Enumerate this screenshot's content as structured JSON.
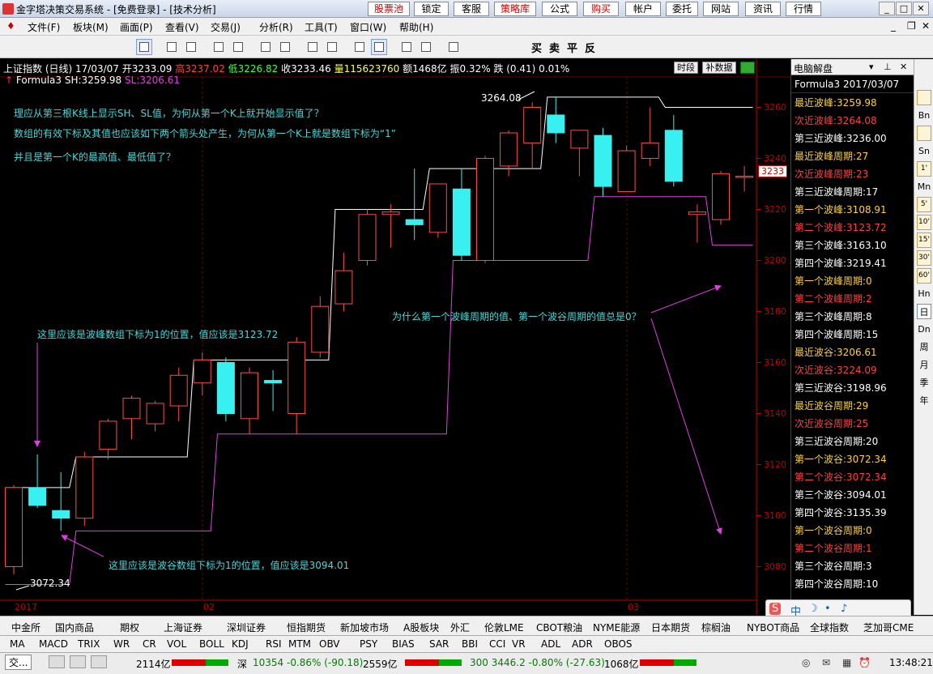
{
  "window": {
    "title": "金字塔决策交易系统 - [免费登录] - [技术分析]",
    "top_buttons": [
      "股票池",
      "锁定",
      "客服",
      "策略库",
      "公式",
      "购买",
      "帐户",
      "委托",
      "网站",
      "资讯",
      "行情"
    ]
  },
  "menus": [
    "文件(F)",
    "板块(M)",
    "画面(P)",
    "查看(V)",
    "交易(J)",
    "分析(R)",
    "工具(T)",
    "窗口(W)",
    "帮助(H)"
  ],
  "toolbar": {
    "trade_labels": [
      "买",
      "卖",
      "平",
      "反"
    ]
  },
  "chart": {
    "info": {
      "name": "上证指数 (日线)",
      "date": "17/03/07",
      "open": "开3233.09",
      "high": "高3237.02",
      "low": "低3226.82",
      "close": "收3233.46",
      "vol": "量115623760",
      "amount": "额1468亿",
      "amp": "振0.32%",
      "chg": "跌 (0.41) 0.01%"
    },
    "formula_line": {
      "name": "Formula3",
      "sh": "SH:3259.98",
      "sl": "SL:3206.61"
    },
    "buttons": [
      "时段",
      "补数据"
    ],
    "last_price_tag": "3233",
    "peak_label": "3264.08",
    "trough_label": "3072.34",
    "notes": [
      "理应从第三根K线上显示SH、SL值，为何从第一个K上就开始显示值了？",
      "数组的有效下标及其值也应该如下两个箭头处产生，为何从第一个K上就是数组下标为“1”",
      "并且是第一个K的最高值、最低值了？",
      "这里应该是波峰数组下标为1的位置，值应该是3123.72",
      "这里应该是波谷数组下标为1的位置，值应该是3094.01",
      "为什么第一个波峰周期的值、第一个波谷周期的值总是0？"
    ],
    "x_ticks": [
      "2017",
      "02",
      "03"
    ],
    "y_ticks": [
      "3260",
      "3240",
      "3220",
      "3200",
      "3180",
      "3160",
      "3140",
      "3120",
      "3100",
      "3080"
    ]
  },
  "chart_data": {
    "type": "candlestick",
    "ylim": [
      3070,
      3270
    ],
    "candles": [
      {
        "o": 3080,
        "h": 3112,
        "l": 3077,
        "c": 3111
      },
      {
        "o": 3111,
        "h": 3124,
        "l": 3103,
        "c": 3104
      },
      {
        "o": 3102,
        "h": 3117,
        "l": 3094,
        "c": 3099
      },
      {
        "o": 3099,
        "h": 3125,
        "l": 3096,
        "c": 3123
      },
      {
        "o": 3126,
        "h": 3138,
        "l": 3122,
        "c": 3137
      },
      {
        "o": 3138,
        "h": 3147,
        "l": 3130,
        "c": 3146
      },
      {
        "o": 3136,
        "h": 3145,
        "l": 3133,
        "c": 3144
      },
      {
        "o": 3143,
        "h": 3158,
        "l": 3137,
        "c": 3155
      },
      {
        "o": 3152,
        "h": 3164,
        "l": 3147,
        "c": 3161
      },
      {
        "o": 3160,
        "h": 3162,
        "l": 3137,
        "c": 3140
      },
      {
        "o": 3138,
        "h": 3158,
        "l": 3132,
        "c": 3156
      },
      {
        "o": 3153,
        "h": 3157,
        "l": 3141,
        "c": 3152
      },
      {
        "o": 3140,
        "h": 3170,
        "l": 3132,
        "c": 3168
      },
      {
        "o": 3164,
        "h": 3186,
        "l": 3162,
        "c": 3182
      },
      {
        "o": 3183,
        "h": 3203,
        "l": 3180,
        "c": 3196
      },
      {
        "o": 3200,
        "h": 3220,
        "l": 3198,
        "c": 3218
      },
      {
        "o": 3218,
        "h": 3222,
        "l": 3205,
        "c": 3219
      },
      {
        "o": 3216,
        "h": 3236,
        "l": 3208,
        "c": 3214
      },
      {
        "o": 3211,
        "h": 3230,
        "l": 3209,
        "c": 3230
      },
      {
        "o": 3228,
        "h": 3236,
        "l": 3200,
        "c": 3202
      },
      {
        "o": 3200,
        "h": 3241,
        "l": 3199,
        "c": 3240
      },
      {
        "o": 3237,
        "h": 3251,
        "l": 3233,
        "c": 3250
      },
      {
        "o": 3246,
        "h": 3262,
        "l": 3236,
        "c": 3260
      },
      {
        "o": 3257,
        "h": 3264,
        "l": 3246,
        "c": 3250
      },
      {
        "o": 3244,
        "h": 3251,
        "l": 3233,
        "c": 3251
      },
      {
        "o": 3249,
        "h": 3252,
        "l": 3225,
        "c": 3229
      },
      {
        "o": 3227,
        "h": 3245,
        "l": 3227,
        "c": 3243
      },
      {
        "o": 3240,
        "h": 3260,
        "l": 3237,
        "c": 3246
      },
      {
        "o": 3251,
        "h": 3257,
        "l": 3229,
        "c": 3231
      },
      {
        "o": 3218,
        "h": 3222,
        "l": 3207,
        "c": 3219
      },
      {
        "o": 3216,
        "h": 3235,
        "l": 3214,
        "c": 3234
      },
      {
        "o": 3233,
        "h": 3237,
        "l": 3227,
        "c": 3233
      }
    ],
    "sh": [
      3111,
      3111,
      3111,
      3123,
      3123,
      3123,
      3123,
      3123,
      3161,
      3161,
      3161,
      3161,
      3161,
      3161,
      3220,
      3220,
      3220,
      3220,
      3236,
      3236,
      3236,
      3236,
      3236,
      3264,
      3264,
      3264,
      3264,
      3264,
      3260,
      3260,
      3260,
      3260
    ],
    "sl": [
      3073,
      3073,
      3073,
      3094,
      3094,
      3094,
      3094,
      3094,
      3094,
      3132,
      3132,
      3132,
      3132,
      3132,
      3132,
      3132,
      3132,
      3132,
      3132,
      3200,
      3200,
      3200,
      3200,
      3200,
      3200,
      3225,
      3225,
      3225,
      3225,
      3225,
      3206,
      3206
    ]
  },
  "side": {
    "title": "电脑解盘",
    "formula": "Formula3  2017/03/07",
    "rows": [
      {
        "t": "最近波峰:3259.98",
        "c": "#ffd040"
      },
      {
        "t": "次近波峰:3264.08",
        "c": "#ff4040"
      },
      {
        "t": "第三近波峰:3236.00",
        "c": "#ffffff"
      },
      {
        "t": "最近波峰周期:27",
        "c": "#ffd040"
      },
      {
        "t": "次近波峰周期:23",
        "c": "#ff4040"
      },
      {
        "t": "第三近波峰周期:17",
        "c": "#ffffff"
      },
      {
        "t": "第一个波峰:3108.91",
        "c": "#ffd040"
      },
      {
        "t": "第二个波峰:3123.72",
        "c": "#ff4040"
      },
      {
        "t": "第三个波峰:3163.10",
        "c": "#ffffff"
      },
      {
        "t": "第四个波峰:3219.41",
        "c": "#ffffff"
      },
      {
        "t": "第一个波峰周期:0",
        "c": "#ffd040"
      },
      {
        "t": "第二个波峰周期:2",
        "c": "#ff4040"
      },
      {
        "t": "第三个波峰周期:8",
        "c": "#ffffff"
      },
      {
        "t": "第四个波峰周期:15",
        "c": "#ffffff"
      },
      {
        "t": "最近波谷:3206.61",
        "c": "#ffd040"
      },
      {
        "t": "次近波谷:3224.09",
        "c": "#ff4040"
      },
      {
        "t": "第三近波谷:3198.96",
        "c": "#ffffff"
      },
      {
        "t": "最近波谷周期:29",
        "c": "#ffd040"
      },
      {
        "t": "次近波谷周期:25",
        "c": "#ff4040"
      },
      {
        "t": "第三近波谷周期:20",
        "c": "#ffffff"
      },
      {
        "t": "第一个波谷:3072.34",
        "c": "#ffd040"
      },
      {
        "t": "第二个波谷:3072.34",
        "c": "#ff4040"
      },
      {
        "t": "第三个波谷:3094.01",
        "c": "#ffffff"
      },
      {
        "t": "第四个波谷:3135.39",
        "c": "#ffffff"
      },
      {
        "t": "第一个波谷周期:0",
        "c": "#ffd040"
      },
      {
        "t": "第二个波谷周期:1",
        "c": "#ff4040"
      },
      {
        "t": "第三个波谷周期:3",
        "c": "#ffffff"
      },
      {
        "t": "第四个波谷周期:10",
        "c": "#ffffff"
      }
    ]
  },
  "right_tools": [
    "Bn",
    "Sn",
    "Mn",
    "Hn",
    "日",
    "Dn",
    "周",
    "月",
    "季",
    "年"
  ],
  "right_icons": [
    "1'",
    "5'",
    "10'",
    "15'",
    "30'",
    "60'"
  ],
  "market_tabs": [
    "中金所",
    "国内商品",
    "期权",
    "上海证券",
    "深圳证券",
    "恒指期货",
    "新加坡市场",
    "A股板块",
    "外汇",
    "伦敦LME",
    "CBOT粮油",
    "NYME能源",
    "日本期货",
    "棕榈油",
    "NYBOT商品",
    "全球指数",
    "芝加哥CME"
  ],
  "indicators": [
    "MA",
    "MACD",
    "TRIX",
    "WR",
    "CR",
    "VOL",
    "BOLL",
    "KDJ",
    "RSI",
    "MTM",
    "OBV",
    "PSY",
    "BIAS",
    "SAR",
    "BBI",
    "CCI",
    "VR",
    "ADL",
    "ADR",
    "OBOS"
  ],
  "status": {
    "left_tab": "交...",
    "sh_amt": "2114亿",
    "sz_label": "深",
    "sz_val": "10354 -0.86% (-90.18)",
    "sz_amt": "2559亿",
    "cyb": "300 3446.2 -0.80% (-27.63)",
    "cyb_amt": "1068亿",
    "time": "13:48:21"
  },
  "ime": [
    "S",
    "中",
    "☽",
    "•",
    "♪"
  ],
  "colors": {
    "up": "#ff4a4a",
    "down": "#38f0f0",
    "sh": "#ffffff",
    "sl": "#e040e0",
    "note": "#48d8d8",
    "axis": "#c00000"
  }
}
